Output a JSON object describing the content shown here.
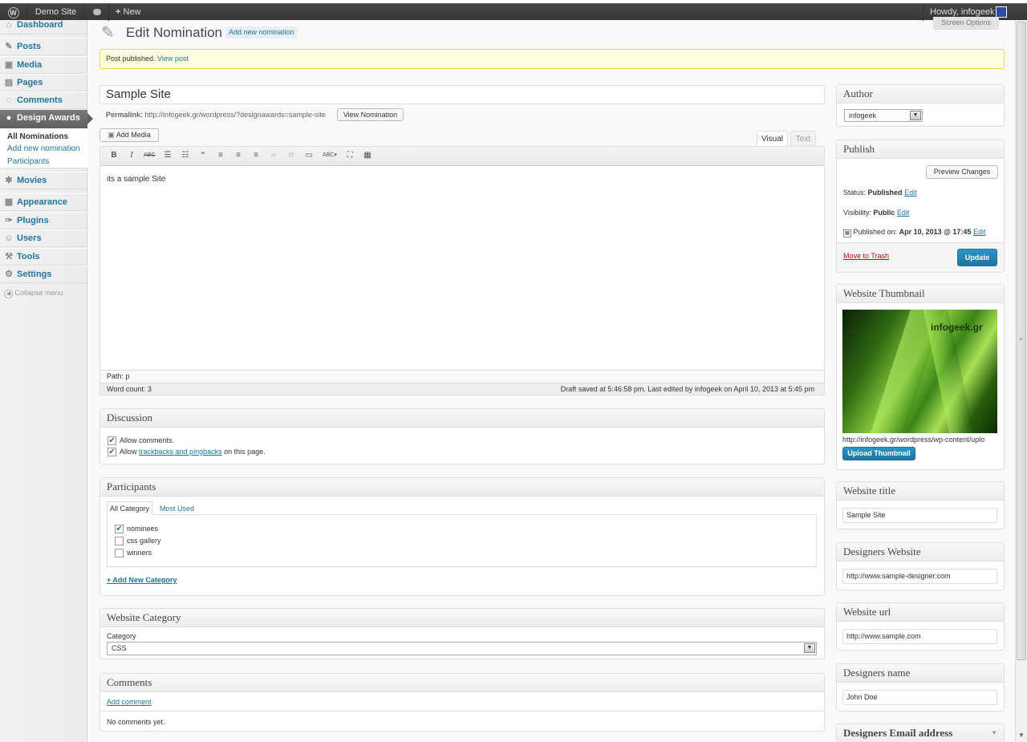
{
  "adminbar": {
    "wp_logo": "wordpress-logo-icon",
    "site_name": "Demo Site",
    "comments_icon": "comment-bubble-icon",
    "new_label": "New",
    "howdy": "Howdy, infogeek"
  },
  "sidebar": {
    "items": [
      {
        "label": "Dashboard",
        "icon": "dashboard-icon"
      },
      {
        "label": "Posts",
        "icon": "pushpin-icon"
      },
      {
        "label": "Media",
        "icon": "media-icon"
      },
      {
        "label": "Pages",
        "icon": "pages-icon"
      },
      {
        "label": "Comments",
        "icon": "comments-icon"
      },
      {
        "label": "Design Awards",
        "icon": "person-icon"
      },
      {
        "label": "Movies",
        "icon": "movies-icon"
      },
      {
        "label": "Appearance",
        "icon": "appearance-icon"
      },
      {
        "label": "Plugins",
        "icon": "plugins-icon"
      },
      {
        "label": "Users",
        "icon": "users-icon"
      },
      {
        "label": "Tools",
        "icon": "tools-icon"
      },
      {
        "label": "Settings",
        "icon": "settings-icon"
      }
    ],
    "submenu": [
      "All Nominations",
      "Add new nomination",
      "Participants"
    ],
    "collapse": "Collapse menu"
  },
  "header": {
    "title": "Edit Nomination",
    "add_new": "Add new nomination",
    "screen_options": "Screen Options"
  },
  "notice": {
    "text": "Post published.",
    "link": "View post"
  },
  "post": {
    "title": "Sample Site",
    "permalink_label": "Permalink:",
    "permalink_url": "http://infogeek.gr/wordpress/?designawards=sample-site",
    "view_button": "View Nomination",
    "add_media": "Add Media",
    "tab_visual": "Visual",
    "tab_text": "Text",
    "body": "its a sample Site",
    "path": "Path: p",
    "word_count": "Word count: 3",
    "draft_saved": "Draft saved at 5:46:58 pm. Last edited by infogeek on April 10, 2013 at 5:45 pm"
  },
  "discussion": {
    "title": "Discussion",
    "allow_comments": "Allow comments.",
    "allow_prefix": "Allow",
    "trackbacks_link": "trackbacks and pingbacks",
    "allow_suffix": "on this page."
  },
  "participants": {
    "title": "Participants",
    "tab_all": "All Category",
    "tab_most": "Most Used",
    "categories": [
      {
        "label": "nominees",
        "checked": true
      },
      {
        "label": "css gallery",
        "checked": false
      },
      {
        "label": "winners",
        "checked": false
      }
    ],
    "add_new": "+ Add New Category"
  },
  "website_category": {
    "title": "Website Category",
    "label": "Category",
    "value": "CSS"
  },
  "comments": {
    "title": "Comments",
    "add": "Add comment",
    "none": "No comments yet."
  },
  "author": {
    "title": "Author",
    "value": "infogeek"
  },
  "publish": {
    "title": "Publish",
    "preview": "Preview Changes",
    "status_label": "Status:",
    "status_value": "Published",
    "visibility_label": "Visibility:",
    "visibility_value": "Public",
    "published_label": "Published on:",
    "published_value": "Apr 10, 2013 @ 17:45",
    "edit": "Edit",
    "trash": "Move to Trash",
    "update": "Update"
  },
  "thumbnail": {
    "title": "Website Thumbnail",
    "watermark": "infogeek.gr",
    "url": "http://infogeek.gr/wordpress/wp-content/uplo",
    "upload": "Upload Thumbnail"
  },
  "website_title": {
    "title": "Website title",
    "value": "Sample Site"
  },
  "designers_website": {
    "title": "Designers Website",
    "value": "http://www.sample-designer.com"
  },
  "website_url": {
    "title": "Website url",
    "value": "http://www.sample.com"
  },
  "designers_name": {
    "title": "Designers name",
    "value": "John Doe"
  },
  "designers_email": {
    "title": "Designers Email address"
  }
}
